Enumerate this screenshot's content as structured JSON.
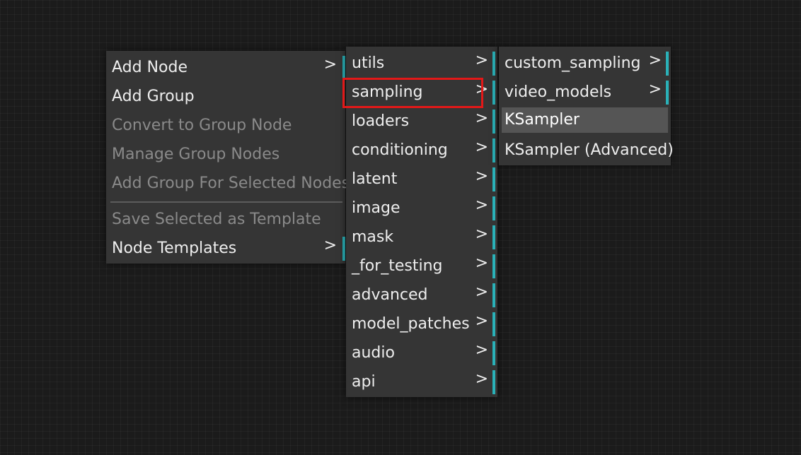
{
  "context_menu": {
    "items": [
      {
        "label": "Add Node",
        "arrow": ">"
      },
      {
        "label": "Add Group"
      },
      {
        "label": "Convert to Group Node"
      },
      {
        "label": "Manage Group Nodes"
      },
      {
        "label": "Add Group For Selected Nodes"
      },
      {
        "label": "Save Selected as Template"
      },
      {
        "label": "Node Templates",
        "arrow": ">"
      }
    ]
  },
  "categories_menu": {
    "items": [
      {
        "label": "utils",
        "arrow": ">"
      },
      {
        "label": "sampling",
        "arrow": ">"
      },
      {
        "label": "loaders",
        "arrow": ">"
      },
      {
        "label": "conditioning",
        "arrow": ">"
      },
      {
        "label": "latent",
        "arrow": ">"
      },
      {
        "label": "image",
        "arrow": ">"
      },
      {
        "label": "mask",
        "arrow": ">"
      },
      {
        "label": "_for_testing",
        "arrow": ">"
      },
      {
        "label": "advanced",
        "arrow": ">"
      },
      {
        "label": "model_patches",
        "arrow": ">"
      },
      {
        "label": "audio",
        "arrow": ">"
      },
      {
        "label": "api",
        "arrow": ">"
      }
    ]
  },
  "sampling_menu": {
    "items": [
      {
        "label": "custom_sampling",
        "arrow": ">"
      },
      {
        "label": "video_models",
        "arrow": ">"
      },
      {
        "label": "KSampler"
      },
      {
        "label": "KSampler (Advanced)"
      }
    ]
  },
  "colors": {
    "canvas_background": "#1b1b1b",
    "menu_background": "#353535",
    "hover_background": "#555555",
    "submenu_indicator": "#2ab1b8",
    "focus_outline": "#e31818",
    "disabled_text": "#8a8a8a"
  }
}
